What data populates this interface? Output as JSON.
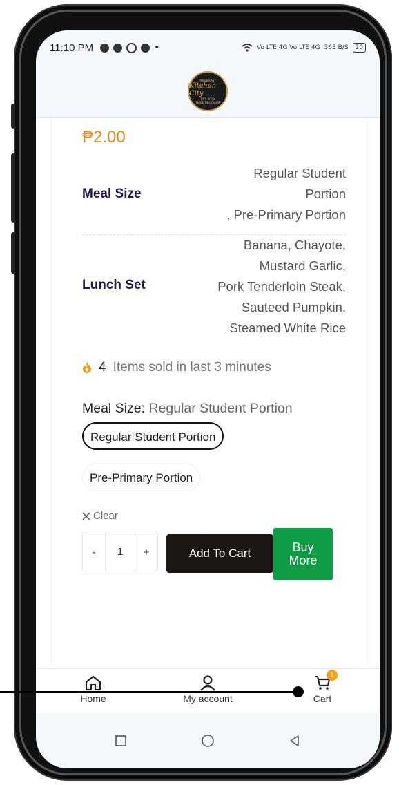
{
  "status_bar": {
    "time": "11:10 PM",
    "network": "Vo LTE 4G Vo LTE 4G",
    "speed": "363 B/S",
    "battery": "20"
  },
  "product": {
    "price": "₱2.00",
    "attributes": [
      {
        "label": "Meal Size",
        "value_lines": [
          "Regular Student",
          "Portion",
          ", Pre-Primary Portion"
        ]
      },
      {
        "label": "Lunch Set",
        "value_lines": [
          "Banana, Chayote,",
          "Mustard Garlic,",
          "Pork Tenderloin Steak,",
          "Sauteed Pumpkin,",
          "Steamed White Rice"
        ]
      }
    ],
    "sold": {
      "count": "4",
      "text": "Items sold in last 3 minutes"
    },
    "meal_size": {
      "label": "Meal Size",
      "separator": ":",
      "selected": "Regular Student Portion"
    },
    "options": [
      "Regular Student Portion",
      "Pre-Primary Portion"
    ],
    "clear_label": "Clear",
    "quantity": {
      "minus": "-",
      "value": "1",
      "plus": "+"
    },
    "add_to_cart_label": "Add To Cart",
    "buy_more_lines": [
      "Buy",
      "More"
    ]
  },
  "bottom_nav": {
    "items": [
      {
        "label": "Home",
        "icon": "home-icon"
      },
      {
        "label": "My account",
        "icon": "user-icon"
      },
      {
        "label": "Cart",
        "icon": "cart-icon",
        "badge": "1"
      }
    ]
  },
  "logo": {
    "top": "MADE EASY",
    "main": "Kitchen City",
    "est": "EST. 2019",
    "bottom": "MADE DELICIOUS"
  },
  "colors": {
    "price": "#e0891c",
    "label": "#1f1a4e",
    "add_to_cart": "#1d1713",
    "buy_more": "#0f9c45",
    "badge": "#f5a11a"
  }
}
